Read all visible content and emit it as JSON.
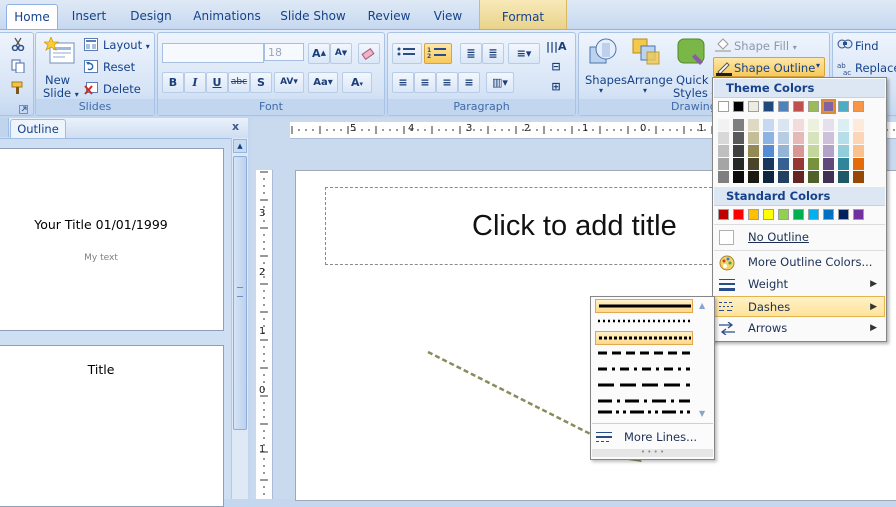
{
  "tabs": {
    "home": "Home",
    "insert": "Insert",
    "design": "Design",
    "animations": "Animations",
    "slideshow": "Slide Show",
    "review": "Review",
    "view": "View",
    "format": "Format"
  },
  "ribbon": {
    "slides_group": {
      "label": "Slides",
      "new_slide": "New",
      "new_slide2": "Slide",
      "layout": "Layout",
      "reset": "Reset",
      "delete": "Delete"
    },
    "font_group": {
      "label": "Font",
      "font_size": "18"
    },
    "paragraph_group": {
      "label": "Paragraph"
    },
    "drawing_group": {
      "label": "Drawing",
      "shapes": "Shapes",
      "arrange": "Arrange",
      "quick": "Quick",
      "styles": "Styles",
      "shape_fill": "Shape Fill",
      "shape_outline": "Shape Outline"
    },
    "editing_group": {
      "find": "Find",
      "replace": "Replace"
    }
  },
  "left_panel": {
    "tab": "Outline",
    "close": "x",
    "slide1": {
      "title": "Your Title 01/01/1999",
      "subtitle": "My text"
    },
    "slide2": {
      "title": "Title"
    }
  },
  "slide": {
    "title_placeholder": "Click to add title"
  },
  "ruler_numbers": [
    "5",
    "4",
    "3",
    "2",
    "1",
    "0",
    "1",
    "2"
  ],
  "vruler_numbers": [
    "3",
    "2",
    "1",
    "0",
    "1"
  ],
  "outline_menu": {
    "theme_colors": "Theme Colors",
    "standard_colors": "Standard Colors",
    "no_outline": "No Outline",
    "more_colors": "More Outline Colors...",
    "weight": "Weight",
    "dashes": "Dashes",
    "arrows": "Arrows",
    "theme_top": [
      "#ffffff",
      "#000000",
      "#eeece1",
      "#1f497d",
      "#4f81bd",
      "#c0504d",
      "#9bbb59",
      "#8064a2",
      "#4bacc6",
      "#f79646"
    ],
    "theme_shades": [
      [
        "#f2f2f2",
        "#7f7f7f",
        "#ddd9c3",
        "#c6d9f0",
        "#dbe5f1",
        "#f2dcdb",
        "#ebf1dd",
        "#e5e0ec",
        "#dbeef3",
        "#fdeada"
      ],
      [
        "#d8d8d8",
        "#595959",
        "#c4bd97",
        "#8db3e2",
        "#b8cce4",
        "#e5b9b7",
        "#d7e3bc",
        "#ccc1d9",
        "#b7dde8",
        "#fbd5b5"
      ],
      [
        "#bfbfbf",
        "#3f3f3f",
        "#938953",
        "#548dd4",
        "#95b3d7",
        "#d99694",
        "#c3d69b",
        "#b2a2c7",
        "#92cddc",
        "#fac08f"
      ],
      [
        "#a5a5a5",
        "#262626",
        "#494429",
        "#17365d",
        "#366092",
        "#953734",
        "#76923c",
        "#5f497a",
        "#31859b",
        "#e36c09"
      ],
      [
        "#7f7f7f",
        "#0c0c0c",
        "#1d1b10",
        "#0f243e",
        "#244061",
        "#632423",
        "#4f6128",
        "#3f3151",
        "#205867",
        "#974806"
      ]
    ],
    "standard": [
      "#c00000",
      "#ff0000",
      "#ffc000",
      "#ffff00",
      "#92d050",
      "#00b050",
      "#00b0f0",
      "#0070c0",
      "#002060",
      "#7030a0"
    ]
  },
  "dash_menu": {
    "more_lines": "More Lines..."
  }
}
